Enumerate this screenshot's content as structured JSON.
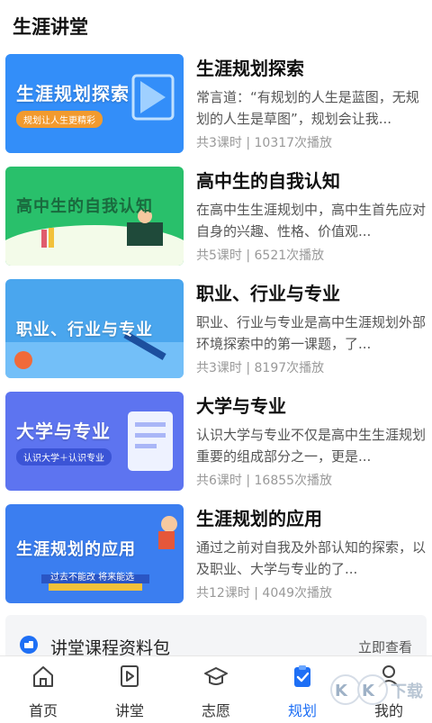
{
  "section_title": "生涯讲堂",
  "courses": [
    {
      "thumb_title": "生涯规划探索",
      "thumb_sub": "规划让人生更精彩",
      "title": "生涯规划探索",
      "desc": "常言道：“有规划的人生是蓝图，无规划的人生是草图”，规划会让我...",
      "meta": "共3课时 | 10317次播放"
    },
    {
      "thumb_title": "高中生的自我认知",
      "thumb_sub": "",
      "title": "高中生的自我认知",
      "desc": "在高中生生涯规划中，高中生首先应对自身的兴趣、性格、价值观...",
      "meta": "共5课时 | 6521次播放"
    },
    {
      "thumb_title": "职业、行业与专业",
      "thumb_sub": "",
      "title": "职业、行业与专业",
      "desc": "职业、行业与专业是高中生涯规划外部环境探索中的第一课题，了...",
      "meta": "共3课时 | 8197次播放"
    },
    {
      "thumb_title": "大学与专业",
      "thumb_sub": "认识大学＋认识专业",
      "title": "大学与专业",
      "desc": "认识大学与专业不仅是高中生生涯规划重要的组成部分之一，更是...",
      "meta": "共6课时 | 16855次播放"
    },
    {
      "thumb_title": "生涯规划的应用",
      "thumb_sub": "过去不能改 将来能选",
      "title": "生涯规划的应用",
      "desc": "通过之前对自我及外部认知的探索，以及职业、大学与专业的了...",
      "meta": "共12课时 | 4049次播放"
    }
  ],
  "pack": {
    "title": "讲堂课程资料包",
    "link": "立即查看"
  },
  "tabs": [
    {
      "label": "首页",
      "icon": "home-icon"
    },
    {
      "label": "讲堂",
      "icon": "play-book-icon"
    },
    {
      "label": "志愿",
      "icon": "graduation-cap-icon"
    },
    {
      "label": "规划",
      "icon": "clipboard-check-icon"
    },
    {
      "label": "我的",
      "icon": "user-icon"
    }
  ],
  "active_tab": "规划",
  "colors": {
    "accent": "#1e6ff5",
    "thumb_bg": [
      "#2b86f3",
      "#29c06b",
      "#4aa6ee",
      "#5d74f0",
      "#3b7ef0"
    ]
  },
  "watermark": "KK下载"
}
